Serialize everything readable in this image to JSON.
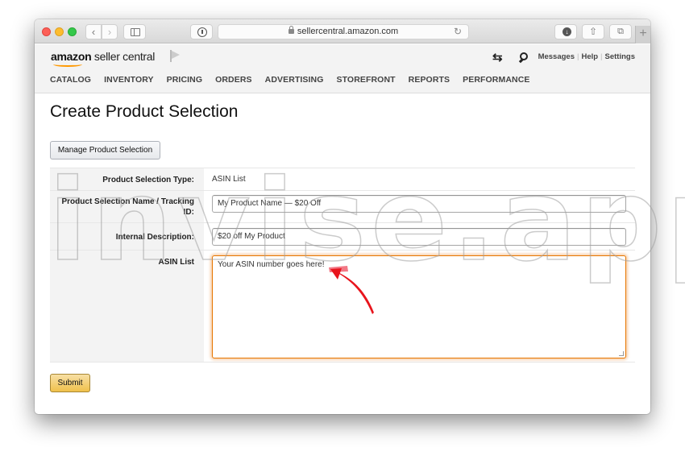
{
  "browser": {
    "url": "sellercentral.amazon.com",
    "back_glyph": "‹",
    "forward_glyph": "›",
    "reload_glyph": "↻",
    "download_glyph": "↓",
    "share_glyph": "⇧",
    "tabs_glyph": "⧉",
    "newtab_glyph": "+"
  },
  "header": {
    "logo_bold": "amazon",
    "logo_rest": " seller central",
    "swap_glyph": "⇆",
    "toplinks": [
      "Messages",
      "Help",
      "Settings"
    ],
    "nav": [
      "CATALOG",
      "INVENTORY",
      "PRICING",
      "ORDERS",
      "ADVERTISING",
      "STOREFRONT",
      "REPORTS",
      "PERFORMANCE"
    ]
  },
  "page": {
    "title": "Create Product Selection",
    "manage_button": "Manage Product Selection",
    "submit_button": "Submit"
  },
  "form": {
    "type_label": "Product Selection Type:",
    "type_value": "ASIN List",
    "name_label": "Product Selection Name / Tracking ID:",
    "name_value": "My Product Name — $20 Off",
    "desc_label": "Internal Description:",
    "desc_value": "$20 off My Product",
    "asin_label": "ASIN List",
    "asin_value": "Your ASIN number goes here!"
  },
  "annotation": {
    "color": "#e8141c"
  },
  "watermark": "invise.app"
}
